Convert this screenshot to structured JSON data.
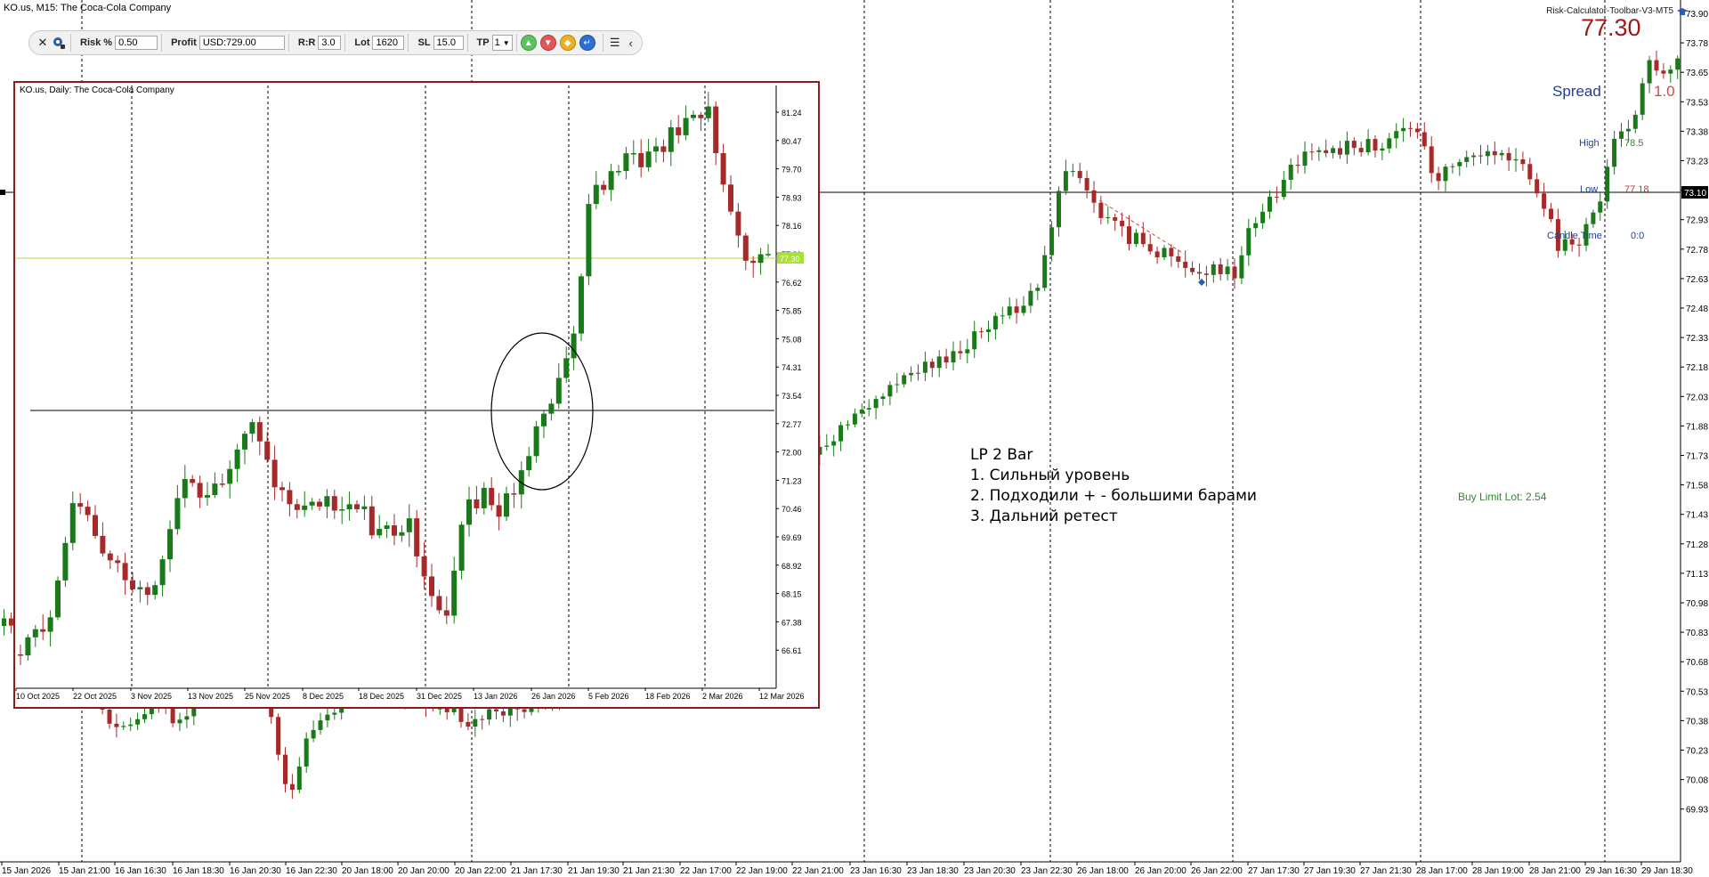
{
  "main_chart": {
    "title": "KO.us, M15:  The Coca-Cola Company",
    "price_labels": [
      "73.90",
      "73.78",
      "73.65",
      "73.53",
      "73.38",
      "73.23",
      "73.10",
      "72.93",
      "72.78",
      "72.63",
      "72.48",
      "72.33",
      "72.18",
      "72.03",
      "71.88",
      "71.73",
      "71.58",
      "71.43",
      "71.28",
      "71.13",
      "70.98",
      "70.83",
      "70.68",
      "70.53",
      "70.38",
      "70.23",
      "70.08",
      "69.93"
    ],
    "current_price_label": "73.10",
    "time_labels": [
      "15 Jan 2026",
      "15 Jan 21:00",
      "16 Jan 16:30",
      "16 Jan 18:30",
      "16 Jan 20:30",
      "16 Jan 22:30",
      "20 Jan 18:00",
      "20 Jan 20:00",
      "20 Jan 22:00",
      "21 Jan 17:30",
      "21 Jan 19:30",
      "21 Jan 21:30",
      "22 Jan 17:00",
      "22 Jan 19:00",
      "22 Jan 21:00",
      "23 Jan 16:30",
      "23 Jan 18:30",
      "23 Jan 20:30",
      "23 Jan 22:30",
      "26 Jan 18:00",
      "26 Jan 20:00",
      "26 Jan 22:00",
      "27 Jan 17:30",
      "27 Jan 19:30",
      "27 Jan 21:30",
      "28 Jan 17:00",
      "28 Jan 19:00",
      "28 Jan 21:00",
      "29 Jan 16:30",
      "29 Jan 18:30"
    ],
    "colors": {
      "bull": "#1a7a1a",
      "bear": "#a52a2a"
    }
  },
  "inset_chart": {
    "title": "KO.us, Daily:  The Coca-Cola Company",
    "price_labels": [
      "81.24",
      "80.47",
      "79.70",
      "78.93",
      "78.16",
      "77.39",
      "76.62",
      "75.85",
      "75.08",
      "74.31",
      "73.54",
      "72.77",
      "72.00",
      "71.23",
      "70.46",
      "69.69",
      "68.92",
      "68.15",
      "67.38",
      "66.61"
    ],
    "current_price_label": "77.30",
    "date_labels": [
      "10 Oct 2025",
      "22 Oct 2025",
      "3 Nov 2025",
      "13 Nov 2025",
      "25 Nov 2025",
      "8 Dec 2025",
      "18 Dec 2025",
      "31 Dec 2025",
      "13 Jan 2026",
      "26 Jan 2026",
      "5 Feb 2026",
      "18 Feb 2026",
      "2 Mar 2026",
      "12 Mar 2026"
    ],
    "border_color": "#8b1a1a"
  },
  "indicator": {
    "name": "Risk-Calculator-Toolbar-V3-MT5",
    "price": "77.30",
    "spread_label": "Spread",
    "spread_value": "1.0",
    "high_label": "High",
    "high_value": "78.5",
    "low_label": "Low",
    "low_value": "77.18",
    "candle_time_label": "Candle Time",
    "candle_time_value": "0:0",
    "buy_limit": "Buy Limit Lot: 2.54"
  },
  "toolbar": {
    "risk_label": "Risk %",
    "risk_value": "0.50",
    "profit_label": "Profit",
    "profit_value": "USD:729.00",
    "rr_label": "R:R",
    "rr_value": "3.0",
    "lot_label": "Lot",
    "lot_value": "1620",
    "sl_label": "SL",
    "sl_value": "15.0",
    "tp_label": "TP",
    "tp_value": "1",
    "close_icon": "close-icon",
    "settings_icon": "settings-icon",
    "buy_icon": "chevron-up-icon",
    "sell_icon": "chevron-down-icon",
    "pending_icon": "diamond-icon",
    "enter_icon": "enter-icon",
    "menu_icon": "menu-icon",
    "collapse_icon": "chevron-left-icon"
  },
  "annotation": {
    "line1": "LP 2 Bar",
    "line2": "1. Сильный уровень",
    "line3": "2. Подходили + - большими барами",
    "line4": "3. Дальний ретест"
  }
}
